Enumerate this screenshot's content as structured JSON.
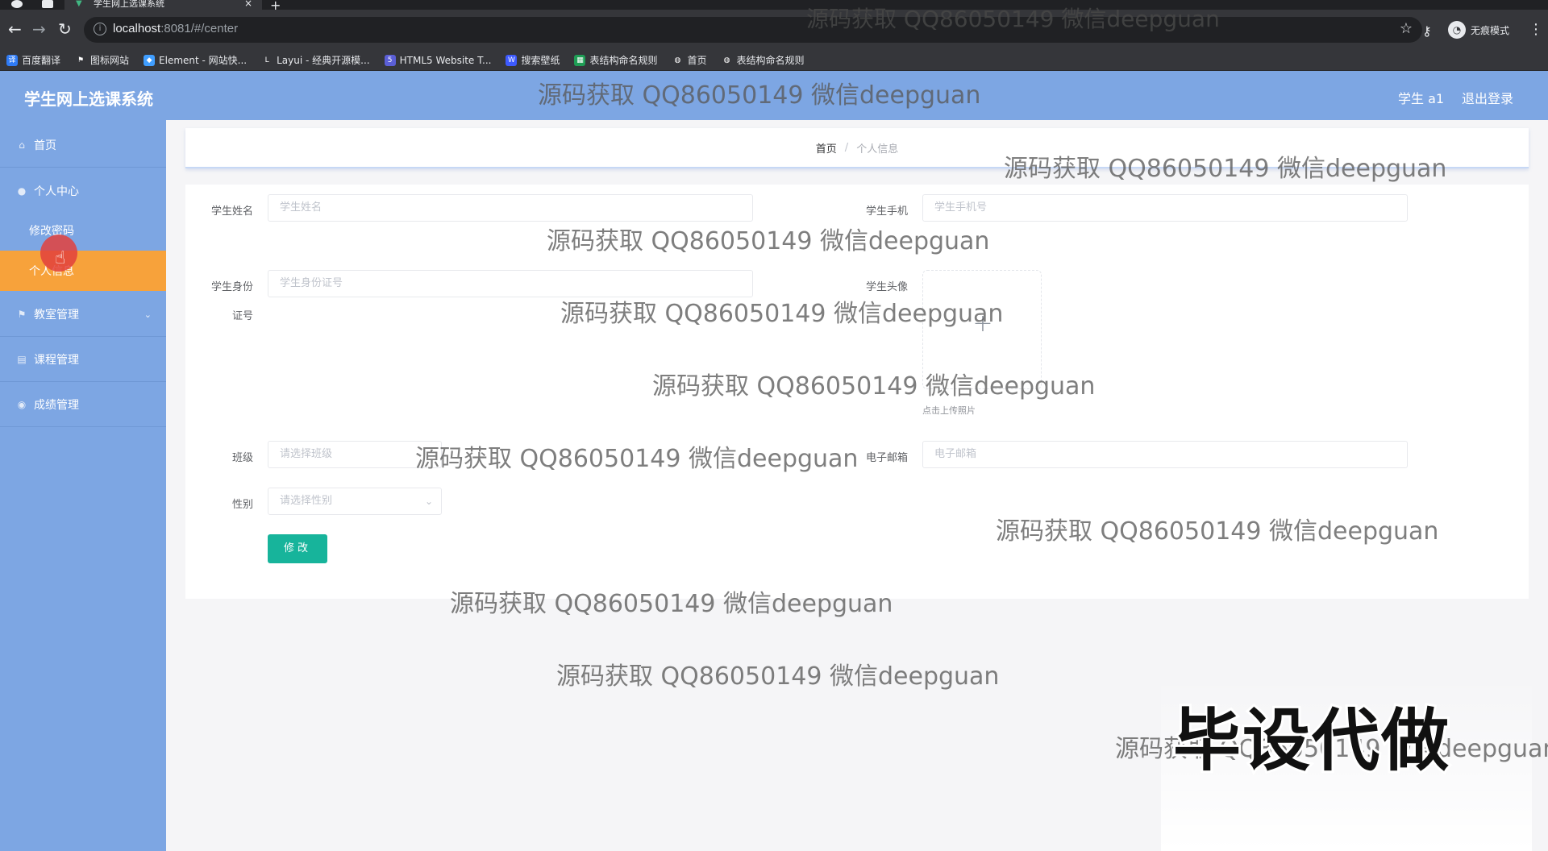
{
  "browser": {
    "tab_title": "学生网上选课系统",
    "tab_close": "×",
    "new_tab": "+",
    "back": "←",
    "forward": "→",
    "reload": "↻",
    "url_host": "localhost",
    "url_rest": ":8081/#/center",
    "star": "☆",
    "key": "⚷",
    "incognito_label": "无痕模式",
    "menu": "⋮",
    "bookmarks": [
      {
        "label": "百度翻译",
        "icon": "译",
        "color": "#2f7bf5"
      },
      {
        "label": "图标网站",
        "icon": "⚑",
        "color": "#35363a"
      },
      {
        "label": "Element - 网站快...",
        "icon": "◆",
        "color": "#409eff"
      },
      {
        "label": "Layui - 经典开源模...",
        "icon": "L",
        "color": "#35363a"
      },
      {
        "label": "HTML5 Website T...",
        "icon": "5",
        "color": "#5b5fd6"
      },
      {
        "label": "搜索壁纸",
        "icon": "W",
        "color": "#3d5afe"
      },
      {
        "label": "表结构命名规则",
        "icon": "▦",
        "color": "#1f9d55"
      },
      {
        "label": "首页",
        "icon": "◍",
        "color": "#35363a"
      },
      {
        "label": "表结构命名规则",
        "icon": "◍",
        "color": "#35363a"
      }
    ]
  },
  "header": {
    "title": "学生网上选课系统",
    "user": "学生 a1",
    "logout": "退出登录"
  },
  "sidebar": {
    "items": [
      {
        "label": "首页",
        "icon": "home-icon",
        "glyph": "⌂"
      },
      {
        "label": "个人中心",
        "icon": "user-icon",
        "glyph": "●"
      },
      {
        "label": "教室管理",
        "icon": "flag-icon",
        "glyph": "⚑"
      },
      {
        "label": "课程管理",
        "icon": "book-icon",
        "glyph": "▤"
      },
      {
        "label": "成绩管理",
        "icon": "chart-icon",
        "glyph": "◉"
      }
    ],
    "sub_items": [
      {
        "label": "修改密码",
        "active": false
      },
      {
        "label": "个人信息",
        "active": true
      }
    ],
    "cursor_glyph": "☝",
    "active_color": "#f7a23b"
  },
  "breadcrumb": {
    "home": "首页",
    "separator": "/",
    "current": "个人信息"
  },
  "form": {
    "name_label": "学生姓名",
    "name_placeholder": "学生姓名",
    "phone_label": "学生手机",
    "phone_placeholder": "学生手机号",
    "id_label_line1": "学生身份",
    "id_label_line2": "证号",
    "id_placeholder": "学生身份证号",
    "avatar_label": "学生头像",
    "upload_plus": "+",
    "upload_tip": "点击上传照片",
    "class_label": "班级",
    "class_placeholder": "请选择班级",
    "email_label": "电子邮箱",
    "email_placeholder": "电子邮箱",
    "gender_label": "性别",
    "gender_placeholder": "请选择性别",
    "gender_arrow": "⌄",
    "submit": "修改"
  },
  "overlay": {
    "watermark": "源码获取 QQ86050149 微信deepguan",
    "stamp": "毕设代做"
  },
  "colors": {
    "header_bg": "#7da6e3",
    "sidebar_bg": "#7da6e3",
    "primary_button": "#17b49b"
  }
}
